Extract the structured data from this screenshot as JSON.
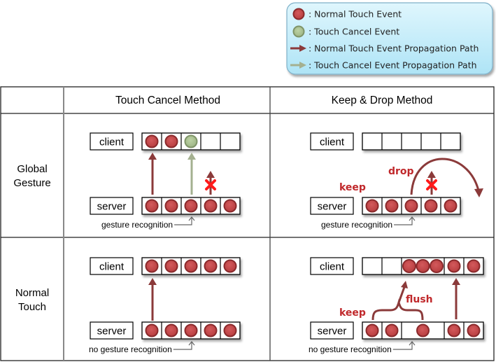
{
  "legend": {
    "items": [
      {
        "icon": "normal-touch-event-circle",
        "label": ": Normal Touch Event"
      },
      {
        "icon": "touch-cancel-event-circle",
        "label": ": Touch Cancel Event"
      },
      {
        "icon": "normal-propagation-arrow",
        "label": ": Normal Touch Event Propagation Path"
      },
      {
        "icon": "cancel-propagation-arrow",
        "label": ": Touch Cancel Event Propagation Path"
      }
    ]
  },
  "table": {
    "column_headers": [
      "",
      "Touch Cancel Method",
      "Keep & Drop Method"
    ],
    "row_headers": [
      {
        "line1": "Global",
        "line2": "Gesture"
      },
      {
        "line1": "Normal",
        "line2": "Touch"
      }
    ]
  },
  "labels": {
    "client": "client",
    "server": "server",
    "gesture_recognition": "gesture recognition",
    "no_gesture_recognition": "no gesture recognition",
    "keep": "keep",
    "drop": "drop",
    "flush": "flush"
  },
  "cells": {
    "global_cancel": {
      "client_queue": [
        "normal",
        "normal",
        "cancel",
        "empty",
        "empty"
      ],
      "server_queue": [
        "normal",
        "normal",
        "normal",
        "normal",
        "normal"
      ]
    },
    "global_keepdrop": {
      "client_queue": [
        "empty",
        "empty",
        "empty",
        "empty",
        "empty"
      ],
      "server_queue": [
        "normal",
        "normal",
        "normal",
        "normal",
        "normal"
      ]
    },
    "normal_cancel": {
      "client_queue": [
        "normal",
        "normal",
        "normal",
        "normal",
        "normal"
      ],
      "server_queue": [
        "normal",
        "normal",
        "normal",
        "normal",
        "normal"
      ]
    },
    "normal_keepdrop": {
      "client_queue": [
        "empty",
        "empty",
        "normal3",
        "normal",
        "normal"
      ],
      "server_queue": [
        "normal",
        "normal",
        "normal",
        "normal",
        "normal"
      ]
    }
  },
  "colors": {
    "normal_event": "#c0484a",
    "normal_event_ring": "#8a2a2c",
    "cancel_event": "#a8c090",
    "cancel_event_ring": "#7f9468",
    "normal_arrow": "#8b3a3a",
    "cancel_arrow": "#a4b090",
    "drop_x": "#ff1a1a",
    "legend_bg": "#c8eefa",
    "legend_border": "#7fb0c8"
  }
}
